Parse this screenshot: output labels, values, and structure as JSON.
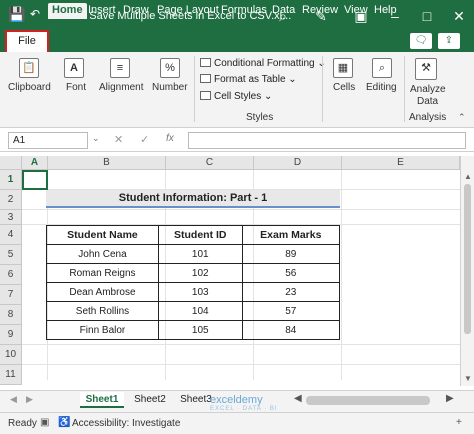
{
  "titlebar": {
    "title": "How to Save Multiple Sheets in Excel to CSV.xl...",
    "colors": {
      "brand": "#1e6e42",
      "highlight": "#d42020"
    }
  },
  "tabs": [
    "File",
    "Home",
    "Insert",
    "Draw",
    "Page Layout",
    "Formulas",
    "Data",
    "Review",
    "View",
    "Help"
  ],
  "ribbon": {
    "clipboard": "Clipboard",
    "font": "Font",
    "alignment": "Alignment",
    "number": "Number",
    "conditional_formatting": "Conditional Formatting",
    "format_as_table": "Format as Table",
    "cell_styles": "Cell Styles",
    "styles": "Styles",
    "cells": "Cells",
    "editing": "Editing",
    "analyze_data_1": "Analyze",
    "analyze_data_2": "Data",
    "analysis": "Analysis"
  },
  "formula": {
    "name_box": "A1",
    "fx": "fx"
  },
  "columns": [
    "A",
    "B",
    "C",
    "D",
    "E"
  ],
  "rows": [
    "1",
    "2",
    "3",
    "4",
    "5",
    "6",
    "7",
    "8",
    "9",
    "10",
    "11"
  ],
  "sheet_title": "Student Information: Part - 1",
  "table": {
    "headers": [
      "Student Name",
      "Student ID",
      "Exam Marks"
    ],
    "rows": [
      [
        "John Cena",
        "101",
        "89"
      ],
      [
        "Roman Reigns",
        "102",
        "56"
      ],
      [
        "Dean Ambrose",
        "103",
        "23"
      ],
      [
        "Seth Rollins",
        "104",
        "57"
      ],
      [
        "Finn Balor",
        "105",
        "84"
      ]
    ]
  },
  "sheets": [
    "Sheet1",
    "Sheet2",
    "Sheet3"
  ],
  "watermark": {
    "name": "exceldemy",
    "tagline": "EXCEL · DATA · BI"
  },
  "status": {
    "ready": "Ready",
    "accessibility": "Accessibility: Investigate"
  }
}
